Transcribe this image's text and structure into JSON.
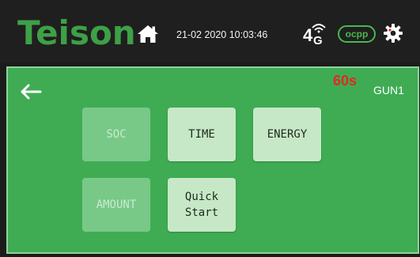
{
  "header": {
    "logo_text": "Teison",
    "datetime": "21-02 2020 10:03:46",
    "network_label": "4G",
    "ocpp_label": "ocpp",
    "icons": [
      "home-icon",
      "signal-icon",
      "gear-icon"
    ]
  },
  "panel": {
    "timer": "60s",
    "gun_label": "GUN1",
    "back_icon": "arrow-left-icon",
    "tiles": [
      {
        "label": "SOC",
        "enabled": false
      },
      {
        "label": "TIME",
        "enabled": true
      },
      {
        "label": "ENERGY",
        "enabled": true
      },
      {
        "label": "AMOUNT",
        "enabled": false
      },
      {
        "label": "Quick\nStart",
        "enabled": true
      }
    ]
  },
  "colors": {
    "brand_green": "#3ea047",
    "panel_green": "#3fac54",
    "tile_active": "#c6e8c6",
    "tile_disabled": "#78c987",
    "timer_red": "#e02a1f",
    "header_bg": "#1f1f1f"
  }
}
